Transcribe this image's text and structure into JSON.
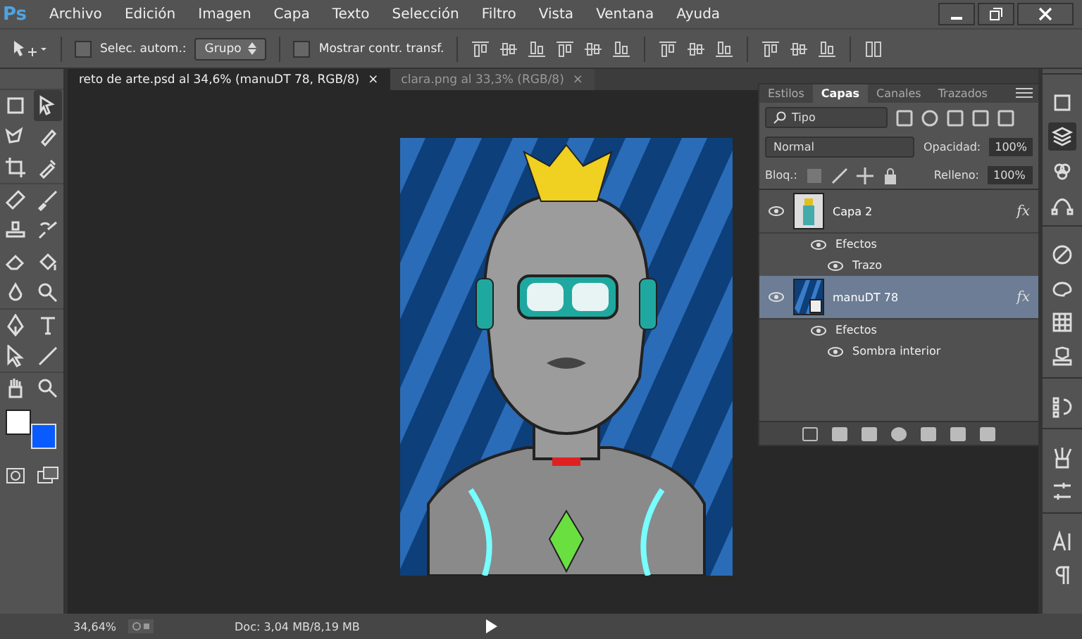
{
  "app_logo": "Ps",
  "menu": [
    "Archivo",
    "Edición",
    "Imagen",
    "Capa",
    "Texto",
    "Selección",
    "Filtro",
    "Vista",
    "Ventana",
    "Ayuda"
  ],
  "options_bar": {
    "auto_select": {
      "label": "Selec. autom.:",
      "checked": false
    },
    "auto_select_mode": "Grupo",
    "show_transform": {
      "label": "Mostrar contr. transf.",
      "checked": false
    }
  },
  "document_tabs": [
    {
      "label": "reto de arte.psd al 34,6% (manuDT 78, RGB/8)",
      "selected": true,
      "close": "×"
    },
    {
      "label": "clara.png al 33,3% (RGB/8)",
      "selected": false,
      "close": "×"
    }
  ],
  "panel": {
    "tabs": [
      {
        "label": "Estilos",
        "selected": false
      },
      {
        "label": "Capas",
        "selected": true
      },
      {
        "label": "Canales",
        "selected": false
      },
      {
        "label": "Trazados",
        "selected": false
      }
    ],
    "filter": "Tipo",
    "blend_mode": "Normal",
    "opacity_label": "Opacidad:",
    "opacity": "100%",
    "lock_label": "Bloq.:",
    "fill_label": "Relleno:",
    "fill": "100%",
    "layers": [
      {
        "name": "Capa 2",
        "selected": false,
        "visible": true,
        "kind": "pixel",
        "fx": "fx",
        "children": [
          {
            "name": "Efectos",
            "visible": true,
            "children": [
              {
                "name": "Trazo",
                "visible": true
              }
            ]
          }
        ]
      },
      {
        "name": "manuDT 78",
        "selected": true,
        "visible": true,
        "kind": "smart_object",
        "fx": "fx",
        "children": [
          {
            "name": "Efectos",
            "visible": true,
            "children": [
              {
                "name": "Sombra interior",
                "visible": true
              }
            ]
          }
        ]
      }
    ]
  },
  "status_bar": {
    "zoom": "34,64%",
    "doc": "Doc: 3,04 MB/8,19 MB"
  }
}
